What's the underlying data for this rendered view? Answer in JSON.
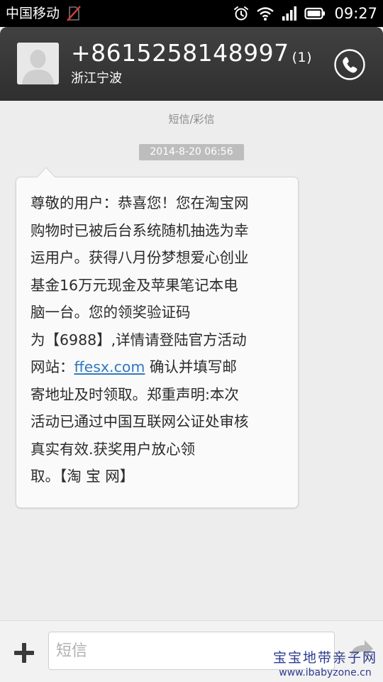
{
  "status_bar": {
    "carrier": "中国移动",
    "time": "09:27",
    "icons": [
      "no-sim-icon",
      "alarm-icon",
      "wifi-icon",
      "signal-icon",
      "battery-icon"
    ]
  },
  "header": {
    "phone_number": "+8615258148997",
    "unread_count": "(1)",
    "region": "浙江宁波",
    "avatar_icon": "person-silhouette-icon",
    "call_icon": "phone-icon"
  },
  "thread": {
    "section_label": "短信/彩信",
    "timestamp": "2014-8-20 06:56",
    "message": {
      "lines": [
        [
          "尊敬的用户：恭喜您！您在淘宝网"
        ],
        [
          "购物时已被后台系统随机抽选为幸"
        ],
        [
          "运用户。获得八月份梦想爱心创业"
        ],
        [
          "基金16万元现金及苹果笔记本电"
        ],
        [
          "脑一台。您的领奖验证码"
        ],
        [
          "为【6988】,详情请登陆官方活动"
        ],
        [
          "网站：",
          "ffesx.com",
          " 确认并填写邮"
        ],
        [
          "寄地址及时领取。郑重声明:本次"
        ],
        [
          "活动已通过中国互联网公证处审核"
        ],
        [
          "真实有效.获奖用户放心领"
        ],
        [
          "取。【淘 宝 网】"
        ]
      ],
      "link_text": "ffesx.com"
    }
  },
  "compose": {
    "placeholder": "短信",
    "value": "",
    "add_icon": "plus-icon",
    "send_icon": "send-icon"
  },
  "watermark": {
    "line1": "宝宝地带亲子网",
    "line2": "www.ibabyzone.cn"
  },
  "colors": {
    "status_bar_bg": "#000000",
    "header_bg": "#3a3a3a",
    "thread_bg": "#ededed",
    "bubble_bg": "#fafafa",
    "timestamp_bg": "#bdbdbd",
    "link": "#2f78c4",
    "watermark": "#2c3b8f"
  }
}
